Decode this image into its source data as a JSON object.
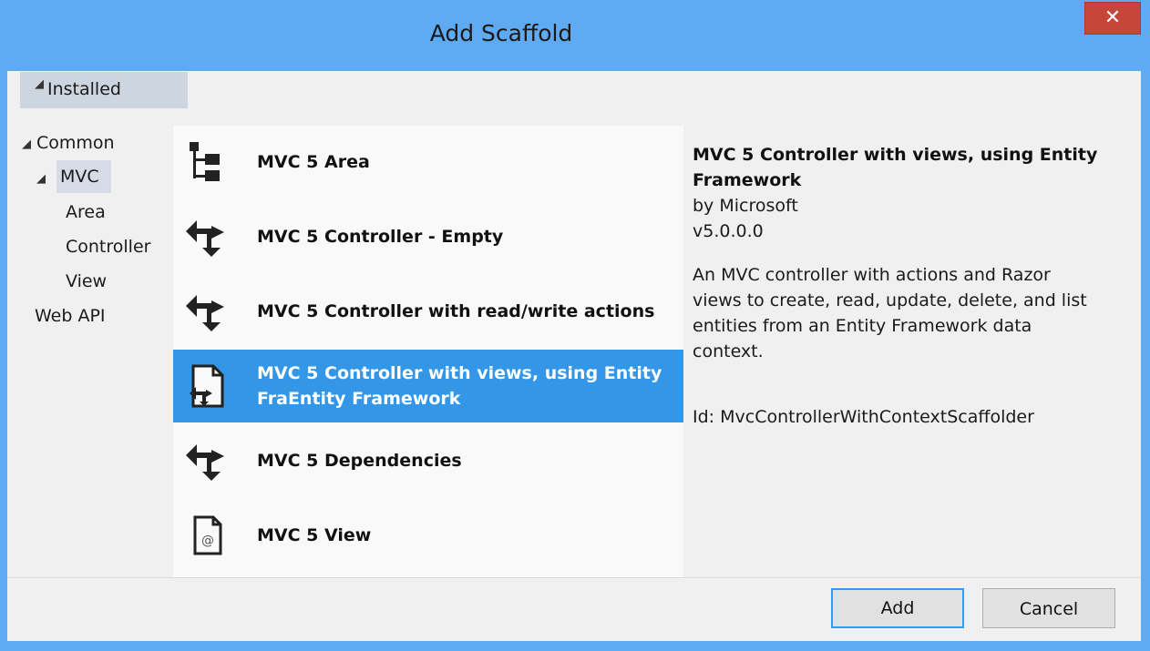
{
  "window": {
    "title": "Add Scaffold",
    "close_glyph": "✕"
  },
  "installed": {
    "label": "Installed",
    "glyph": "◢"
  },
  "tree": {
    "items": [
      {
        "label": "Common",
        "glyph": "◢"
      },
      {
        "label": "MVC",
        "glyph": "◢"
      },
      {
        "label": "Area"
      },
      {
        "label": "Controller"
      },
      {
        "label": "View"
      },
      {
        "label": "Web API"
      }
    ]
  },
  "scaffolds": [
    {
      "label": "MVC 5 Area",
      "icon": "area-icon"
    },
    {
      "label": "MVC 5 Controller - Empty",
      "icon": "controller-icon"
    },
    {
      "label": "MVC 5 Controller with read/write actions",
      "icon": "controller-icon"
    },
    {
      "label_line1": "MVC 5 Controller with views, using Entity",
      "label_line2": "FraEntity Framework",
      "icon": "controller-views-icon",
      "selected": true
    },
    {
      "label": "MVC 5 Dependencies",
      "icon": "controller-icon"
    },
    {
      "label": "MVC 5 View",
      "icon": "view-icon"
    }
  ],
  "details": {
    "title_line1": "MVC 5 Controller with views, using Entity",
    "title_line2": "Framework",
    "author": "by Microsoft",
    "version": "v5.0.0.0",
    "desc_line1": "An MVC controller with actions and Razor",
    "desc_line2": "views to create, read, update, delete, and list",
    "desc_line3": "entities from an Entity Framework data",
    "desc_line4": "context.",
    "id": "Id: MvcControllerWithContextScaffolder"
  },
  "buttons": {
    "add": "Add",
    "cancel": "Cancel"
  },
  "colors": {
    "frame": "#5eaaf3",
    "selection": "#3396e6",
    "close": "#c7463a"
  }
}
